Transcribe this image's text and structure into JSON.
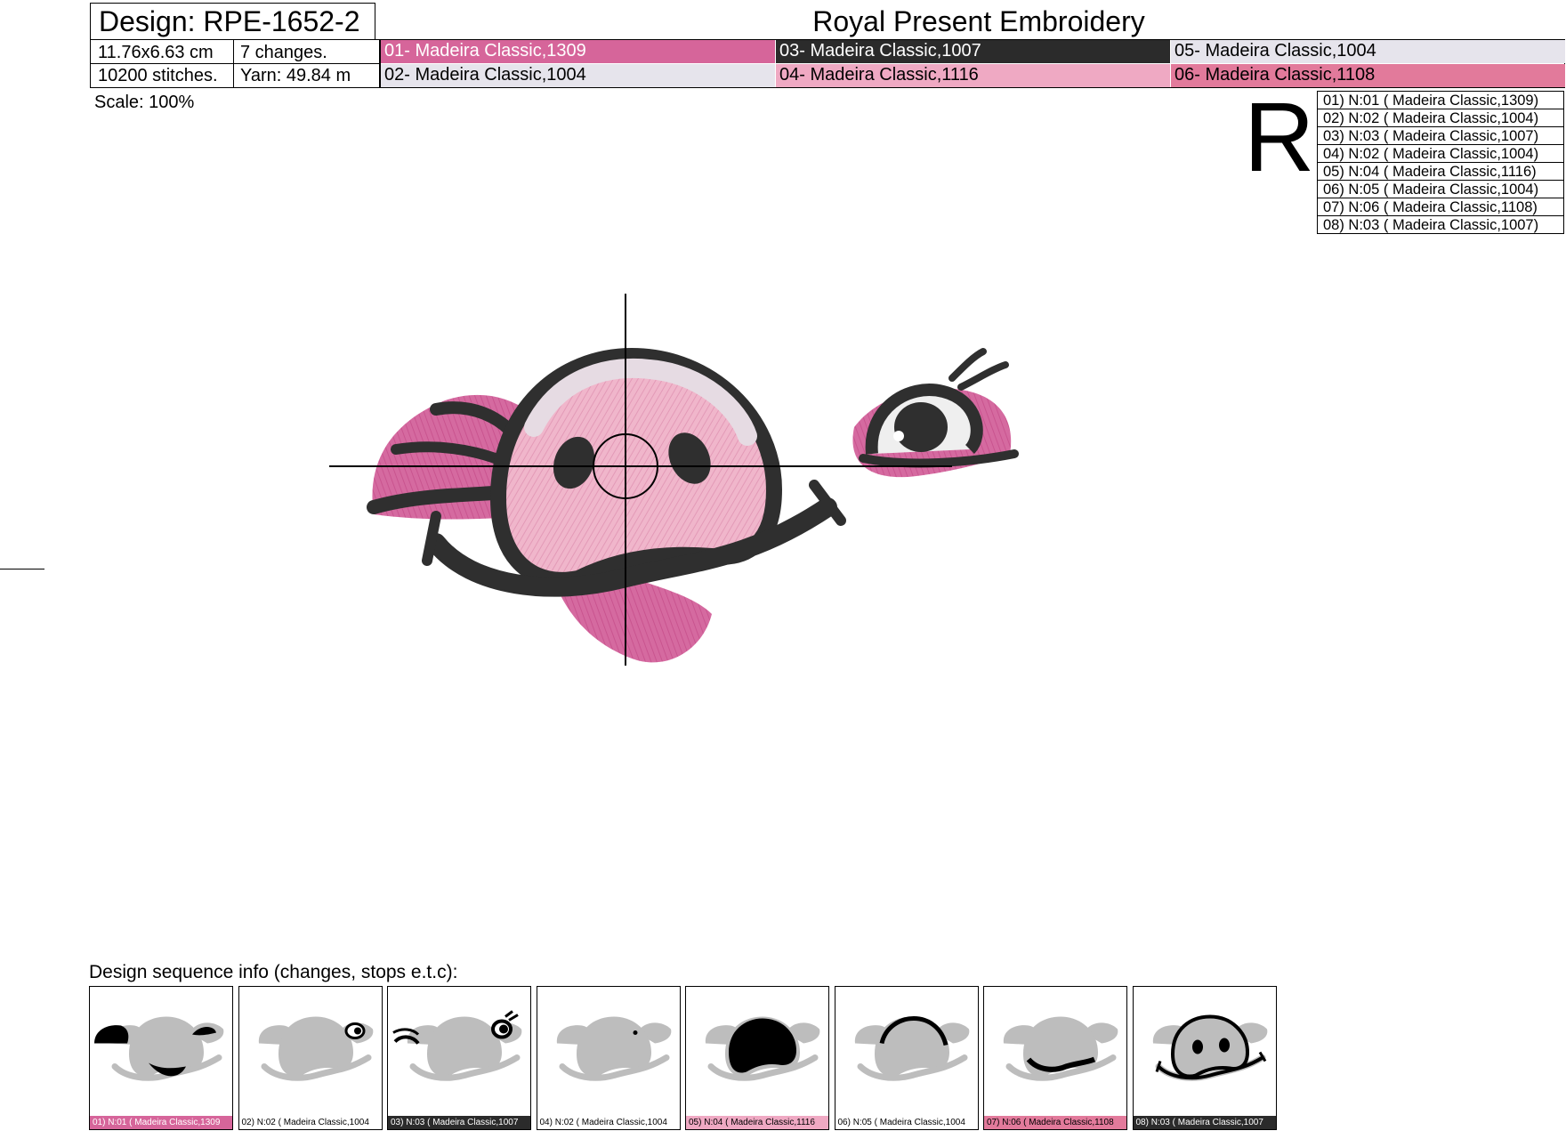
{
  "header": {
    "design_label": "Design: RPE-1652-2",
    "company": "Royal Present Embroidery",
    "size": "11.76x6.63 cm",
    "changes": "7 changes.",
    "stitches": "10200 stitches.",
    "yarn": "Yarn: 49.84 m",
    "scale": "Scale: 100%"
  },
  "threads": [
    {
      "label": "01- Madeira Classic,1309",
      "color": "#d6659a",
      "text_color": "#ffffff"
    },
    {
      "label": "02- Madeira Classic,1004",
      "color": "#e6e4ec",
      "text_color": "#000000"
    },
    {
      "label": "03- Madeira Classic,1007",
      "color": "#2b2b2b",
      "text_color": "#ffffff"
    },
    {
      "label": "04- Madeira Classic,1116",
      "color": "#efa9c3",
      "text_color": "#000000"
    },
    {
      "label": "05- Madeira Classic,1004",
      "color": "#e6e4ec",
      "text_color": "#000000"
    },
    {
      "label": "06- Madeira Classic,1108",
      "color": "#e27a9b",
      "text_color": "#000000"
    }
  ],
  "orientation_letter": "R",
  "steps": [
    "01) N:01 ( Madeira Classic,1309)",
    "02) N:02 ( Madeira Classic,1004)",
    "03) N:03 ( Madeira Classic,1007)",
    "04) N:02 ( Madeira Classic,1004)",
    "05) N:04 ( Madeira Classic,1116)",
    "06) N:05 ( Madeira Classic,1004)",
    "07) N:06 ( Madeira Classic,1108)",
    "08) N:03 ( Madeira Classic,1007)"
  ],
  "sequence": {
    "title": "Design sequence info (changes, stops e.t.c):",
    "items": [
      {
        "caption": "01) N:01 ( Madeira Classic,1309",
        "bg": "#d6659a",
        "fg": "#ffffff",
        "part": "ears-bottom"
      },
      {
        "caption": "02) N:02 ( Madeira Classic,1004",
        "bg": "#ffffff",
        "fg": "#000000",
        "part": "eye-white"
      },
      {
        "caption": "03) N:03 ( Madeira Classic,1007",
        "bg": "#2b2b2b",
        "fg": "#ffffff",
        "part": "ear-lines"
      },
      {
        "caption": "04) N:02 ( Madeira Classic,1004",
        "bg": "#ffffff",
        "fg": "#000000",
        "part": "eye-dot"
      },
      {
        "caption": "05) N:04 ( Madeira Classic,1116",
        "bg": "#efa9c3",
        "fg": "#000000",
        "part": "snout"
      },
      {
        "caption": "06) N:05 ( Madeira Classic,1004",
        "bg": "#ffffff",
        "fg": "#000000",
        "part": "top-arc"
      },
      {
        "caption": "07) N:06 ( Madeira Classic,1108",
        "bg": "#e27a9b",
        "fg": "#000000",
        "part": "mouth-band"
      },
      {
        "caption": "08) N:03 ( Madeira Classic,1007",
        "bg": "#2b2b2b",
        "fg": "#ffffff",
        "part": "outline"
      }
    ]
  },
  "colors": {
    "outline": "#2f2f2f",
    "pink_dark": "#d46d9f",
    "pink_light": "#f1b7cc",
    "pink_pale": "#e8dde6",
    "silhouette": "#bdbdbd"
  }
}
